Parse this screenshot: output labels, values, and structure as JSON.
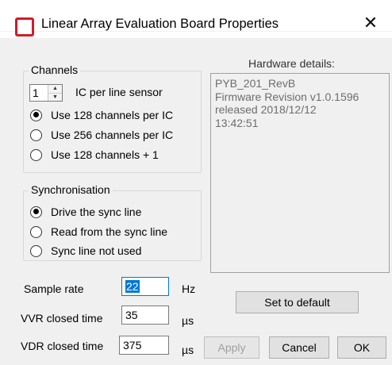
{
  "window": {
    "title": "Linear Array Evaluation Board Properties",
    "close_glyph": "✕",
    "icon": "app-logo-icon",
    "accent_color": "#d01c2a"
  },
  "channels": {
    "group_title": "Channels",
    "ic_count": "1",
    "ic_label": "IC per line sensor",
    "options": [
      {
        "label": "Use 128 channels per IC",
        "checked": true
      },
      {
        "label": "Use 256 channels per IC",
        "checked": false
      },
      {
        "label": "Use 128 channels + 1",
        "checked": false
      }
    ]
  },
  "sync": {
    "group_title": "Synchronisation",
    "options": [
      {
        "label": "Drive the sync line",
        "checked": true
      },
      {
        "label": "Read from the sync line",
        "checked": false
      },
      {
        "label": "Sync line not used",
        "checked": false
      }
    ]
  },
  "hardware": {
    "label": "Hardware details:",
    "lines": [
      "PYB_201_RevB",
      "Firmware Revision v1.0.1596",
      "released 2018/12/12",
      "13:42:51"
    ]
  },
  "params": {
    "sample_rate": {
      "label": "Sample rate",
      "value": "22",
      "unit": "Hz"
    },
    "vvr": {
      "label": "VVR closed time",
      "value": "35",
      "unit": "µs"
    },
    "vdr": {
      "label": "VDR closed time",
      "value": "375",
      "unit": "µs"
    }
  },
  "buttons": {
    "set_default": "Set to default",
    "apply": "Apply",
    "cancel": "Cancel",
    "ok": "OK"
  }
}
